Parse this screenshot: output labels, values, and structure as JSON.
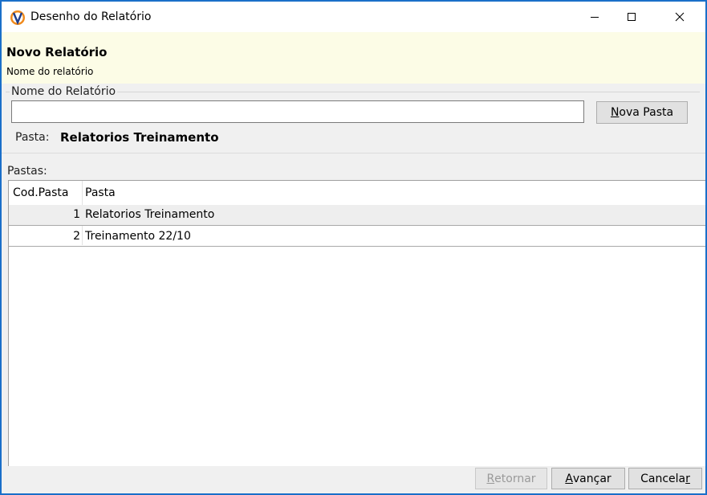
{
  "window": {
    "title": "Desenho do Relatório",
    "icon": "app-logo-icon",
    "accent_color": "#1a6fc9"
  },
  "header": {
    "title": "Novo Relatório",
    "subtitle": "Nome do relatório",
    "background": "#fcfce6"
  },
  "form": {
    "group_label": "Nome do Relatório",
    "name_value": "",
    "nova_pasta": {
      "mnemonic": "N",
      "rest": "ova Pasta"
    },
    "pasta_label": "Pasta:",
    "pasta_value": "Relatorios Treinamento"
  },
  "list": {
    "label": "Pastas:",
    "columns": [
      "Cod.Pasta",
      "Pasta"
    ],
    "rows": [
      {
        "cod": "1",
        "pasta": "Relatorios Treinamento",
        "selected": true
      },
      {
        "cod": "2",
        "pasta": "Treinamento 22/10",
        "selected": false
      }
    ]
  },
  "footer": {
    "retornar": {
      "mnemonic": "R",
      "rest": "etornar",
      "enabled": false
    },
    "avancar": {
      "mnemonic": "A",
      "rest": "vançar"
    },
    "cancelar": {
      "pre": "Cancela",
      "mnemonic": "r"
    }
  }
}
